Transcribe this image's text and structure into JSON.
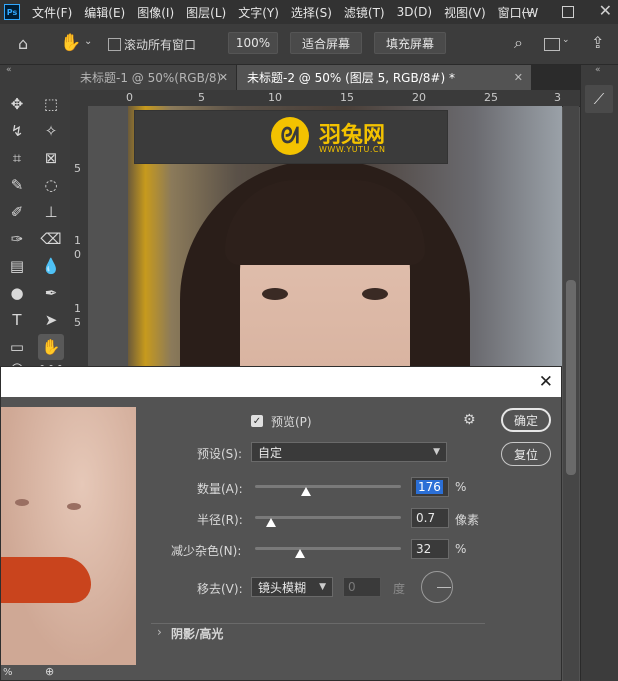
{
  "menubar": {
    "logo": "Ps",
    "items": [
      "文件(F)",
      "编辑(E)",
      "图像(I)",
      "图层(L)",
      "文字(Y)",
      "选择(S)",
      "滤镜(T)",
      "3D(D)",
      "视图(V)",
      "窗口(W"
    ]
  },
  "options": {
    "scroll_all_label": "滚动所有窗口",
    "zoom_value": "100%",
    "fit_screen": "适合屏幕",
    "fill_screen": "填充屏幕"
  },
  "tabs": [
    {
      "label": "未标题-1 @ 50%(RGB/8)"
    },
    {
      "label": "未标题-2 @ 50% (图层 5, RGB/8#) *"
    }
  ],
  "ruler": {
    "top": [
      "0",
      "5",
      "10",
      "15",
      "20",
      "25",
      "3"
    ],
    "left": [
      "5",
      "1",
      "0",
      "1",
      "5"
    ]
  },
  "watermark": {
    "title": "羽兔网",
    "subtitle": "WWW.YUTU.CN"
  },
  "dialog": {
    "preview_label": "预览(P)",
    "ok_label": "确定",
    "reset_label": "复位",
    "preset_label": "预设(S):",
    "preset_value": "自定",
    "amount_label": "数量(A):",
    "amount_value": "176",
    "amount_unit": "%",
    "amount_level": 0.18,
    "radius_label": "半径(R):",
    "radius_value": "0.7",
    "radius_unit": "像素",
    "noise_label": "减少杂色(N):",
    "noise_value": "32",
    "noise_unit": "%",
    "remove_label": "移去(V):",
    "remove_value": "镜头模糊",
    "angle_value": "0",
    "angle_unit": "度",
    "section_label": "阴影/高光",
    "zoom_readout": "%"
  },
  "colors": {
    "accent": "#31a8ff",
    "selection": "#2b6fd6",
    "watermark": "#f3c200"
  }
}
